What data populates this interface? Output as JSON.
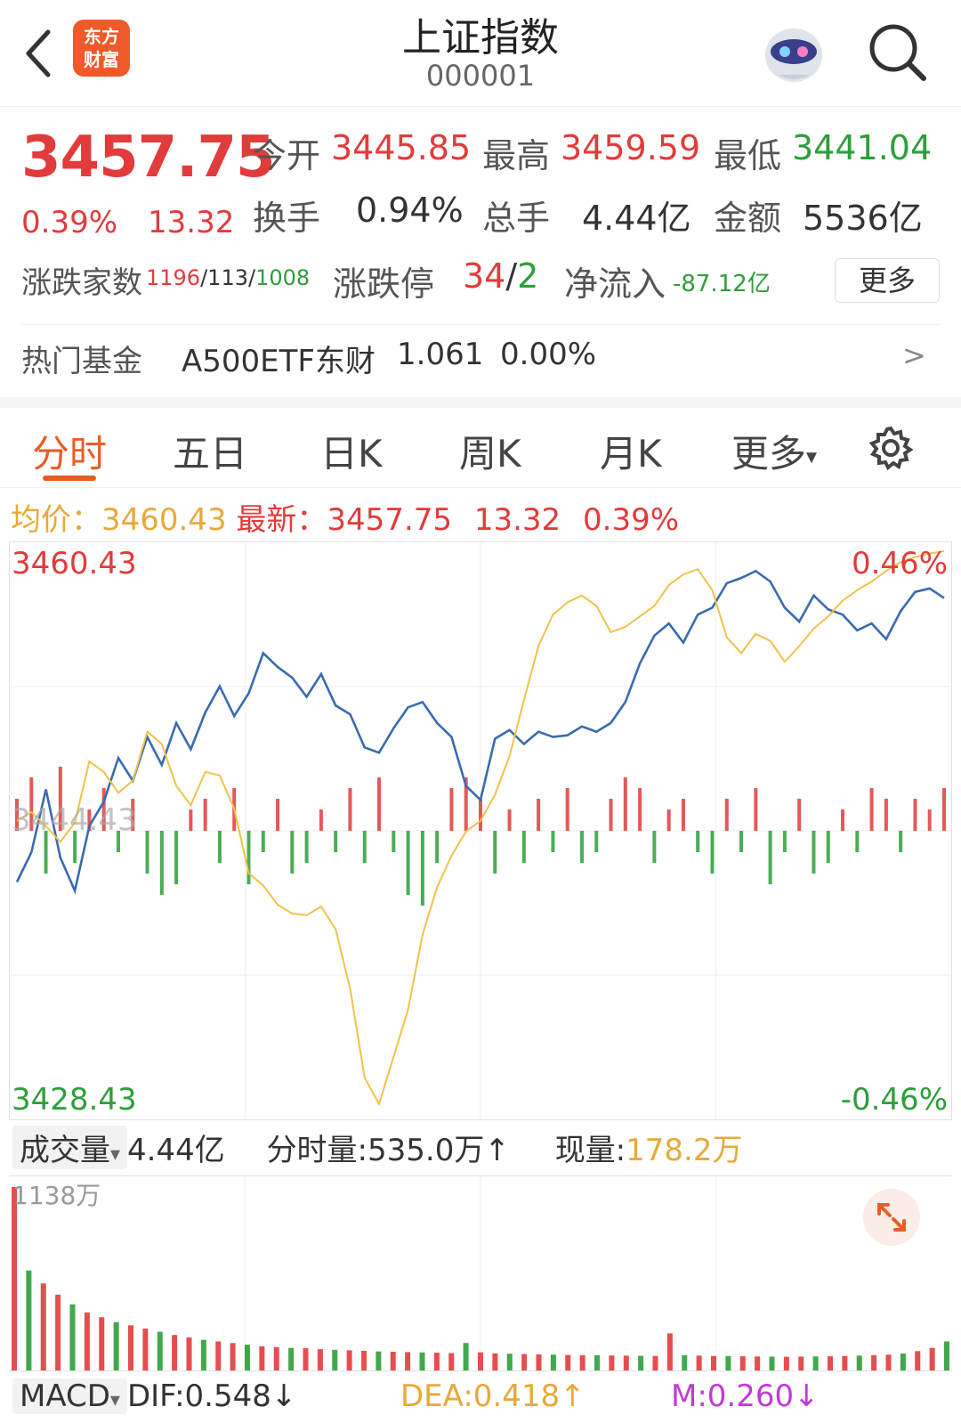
{
  "header": {
    "logo_line1": "东方",
    "logo_line2": "财富",
    "title": "上证指数",
    "code": "000001"
  },
  "quote": {
    "price": "3457.75",
    "change_pct": "0.39%",
    "change": "13.32",
    "open_label": "今开",
    "open": "3445.85",
    "high_label": "最高",
    "high": "3459.59",
    "low_label": "最低",
    "low": "3441.04",
    "turnover_label": "换手",
    "turnover": "0.94%",
    "total_hands_label": "总手",
    "total_hands": "4.44亿",
    "amount_label": "金额",
    "amount": "5536亿"
  },
  "breadth": {
    "label": "涨跌家数",
    "up": "1196",
    "flat": "113",
    "down": "1008",
    "limit_label": "涨跌停",
    "limit_up": "34",
    "limit_down": "2",
    "netflow_label": "净流入",
    "netflow": "-87.12亿",
    "more_button": "更多"
  },
  "fund": {
    "label": "热门基金",
    "name": "A500ETF东财",
    "price": "1.061",
    "pct": "0.00%",
    "arrow": ">"
  },
  "tabs": [
    "分时",
    "五日",
    "日K",
    "周K",
    "月K",
    "更多"
  ],
  "tabs_more_caret": "▾",
  "avg_bar": {
    "avg_label": "均价：",
    "avg": "3460.43",
    "latest_label": "最新：",
    "latest": "3457.75",
    "change": "13.32",
    "pct": "0.39%"
  },
  "colors": {
    "up": "#e23b3b",
    "down": "#2e9e3a",
    "price_line": "#3a6bb0",
    "avg_line": "#f0c24b",
    "accent": "#e85d26"
  },
  "chart_data": {
    "type": "line",
    "series": [
      {
        "values": [
          3441.5,
          3443.2,
          3446.8,
          3442.9,
          3441.0,
          3444.7,
          3446.1,
          3448.6,
          3447.3,
          3449.8,
          3448.2,
          3450.6,
          3449.1,
          3451.2,
          3452.7,
          3451.0,
          3452.3,
          3454.6,
          3453.8,
          3453.2,
          3452.1,
          3453.4,
          3451.6,
          3451.1,
          3449.2,
          3448.9,
          3450.3,
          3451.5,
          3451.8,
          3450.6,
          3449.8,
          3447.0,
          3446.2,
          3449.7,
          3450.2,
          3449.4,
          3450.1,
          3449.8,
          3449.9,
          3450.4,
          3450.1,
          3450.6,
          3451.8,
          3454.0,
          3455.6,
          3456.3,
          3455.2,
          3456.8,
          3457.2,
          3458.6,
          3458.9,
          3459.3,
          3458.7,
          3457.2,
          3456.4,
          3457.9,
          3457.1,
          3456.8,
          3455.9,
          3456.3,
          3455.4,
          3457.0,
          3458.1,
          3458.3,
          3457.75
        ]
      },
      {
        "values": [
          3445.0,
          3445.5,
          3444.7,
          3443.8,
          3444.9,
          3448.4,
          3447.8,
          3446.6,
          3447.3,
          3450.1,
          3449.4,
          3447.0,
          3445.9,
          3447.8,
          3447.6,
          3445.7,
          3442.0,
          3441.3,
          3440.2,
          3439.7,
          3439.6,
          3440.1,
          3438.8,
          3435.4,
          3430.3,
          3428.8,
          3431.5,
          3434.2,
          3438.5,
          3441.2,
          3443.0,
          3444.4,
          3445.0,
          3446.5,
          3448.7,
          3451.9,
          3455.0,
          3456.8,
          3457.5,
          3457.9,
          3457.3,
          3455.8,
          3456.1,
          3456.7,
          3457.3,
          3458.5,
          3459.1,
          3459.4,
          3458.2,
          3455.5,
          3454.6,
          3455.7,
          3455.3,
          3454.1,
          3455.0,
          3456.0,
          3456.7,
          3457.6,
          3458.2,
          3458.7,
          3459.3,
          3459.8,
          3460.1,
          3460.3,
          3460.43
        ]
      }
    ],
    "ylim": [
      3428.43,
      3460.43
    ],
    "y_top_label": "3460.43",
    "y_bottom_label": "3428.43",
    "y_mid_label": "3444.43",
    "pct_top_label": "0.46%",
    "pct_bottom_label": "-0.46%",
    "flow_bars": [
      3,
      5,
      -4,
      6,
      -3,
      2,
      4,
      -2,
      3,
      -4,
      -6,
      -5,
      2,
      3,
      -3,
      4,
      -5,
      -2,
      3,
      -4,
      -3,
      2,
      -2,
      4,
      -3,
      5,
      -2,
      -6,
      -7,
      -3,
      4,
      5,
      3,
      -4,
      2,
      -3,
      3,
      -2,
      4,
      -3,
      -2,
      3,
      5,
      4,
      -3,
      2,
      3,
      -2,
      -4,
      3,
      -2,
      4,
      -5,
      -2,
      3,
      -4,
      -3,
      2,
      -2,
      4,
      3,
      -2,
      3,
      2,
      4
    ],
    "volume_bars": [
      1138,
      620,
      540,
      470,
      410,
      360,
      330,
      300,
      280,
      260,
      240,
      220,
      205,
      190,
      180,
      170,
      160,
      150,
      145,
      140,
      138,
      132,
      128,
      125,
      122,
      118,
      116,
      114,
      112,
      110,
      108,
      170,
      112,
      106,
      104,
      102,
      100,
      98,
      96,
      95,
      94,
      93,
      92,
      91,
      90,
      230,
      95,
      92,
      90,
      89,
      88,
      87,
      86,
      85,
      86,
      87,
      88,
      90,
      92,
      95,
      98,
      105,
      120,
      140,
      180
    ]
  },
  "volume_bar": {
    "selector_label": "成交量",
    "caret": "▾",
    "total": "4.44亿",
    "minute_label": "分时量:",
    "minute": "535.0万",
    "minute_arrow": "↑",
    "current_label": "现量:",
    "current": "178.2万",
    "max_label": "1138万"
  },
  "macd": {
    "selector_label": "MACD",
    "caret": "▾",
    "dif": "DIF:0.548",
    "dif_arrow": "↓",
    "dea": "DEA:0.418",
    "dea_arrow": "↑",
    "m": "M:0.260",
    "m_arrow": "↓"
  }
}
